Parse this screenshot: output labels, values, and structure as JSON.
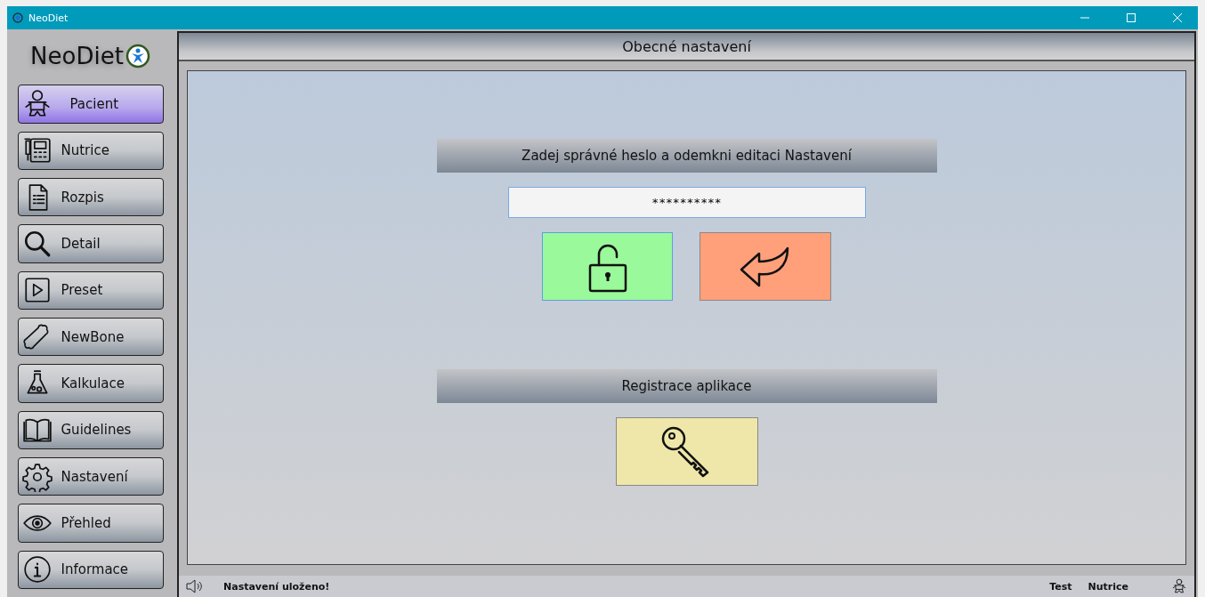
{
  "window": {
    "title": "NeoDiet"
  },
  "sidebar": {
    "logo": "NeoDiet",
    "items": [
      {
        "label": "Pacient",
        "selected": true
      },
      {
        "label": "Nutrice",
        "selected": false
      },
      {
        "label": "Rozpis",
        "selected": false
      },
      {
        "label": "Detail",
        "selected": false
      },
      {
        "label": "Preset",
        "selected": false
      },
      {
        "label": "NewBone",
        "selected": false
      },
      {
        "label": "Kalkulace",
        "selected": false
      },
      {
        "label": "Guidelines",
        "selected": false
      },
      {
        "label": "Nastavení",
        "selected": false
      },
      {
        "label": "Přehled",
        "selected": false
      },
      {
        "label": "Informace",
        "selected": false
      }
    ]
  },
  "page": {
    "title": "Obecné nastavení",
    "password_section": {
      "heading": "Zadej správné heslo a odemkni editaci Nastavení",
      "value": "**********"
    },
    "registration_section": {
      "heading": "Registrace aplikace"
    }
  },
  "status_bar": {
    "message": "Nastavení uloženo!",
    "user": "Test",
    "role": "Nutrice"
  }
}
